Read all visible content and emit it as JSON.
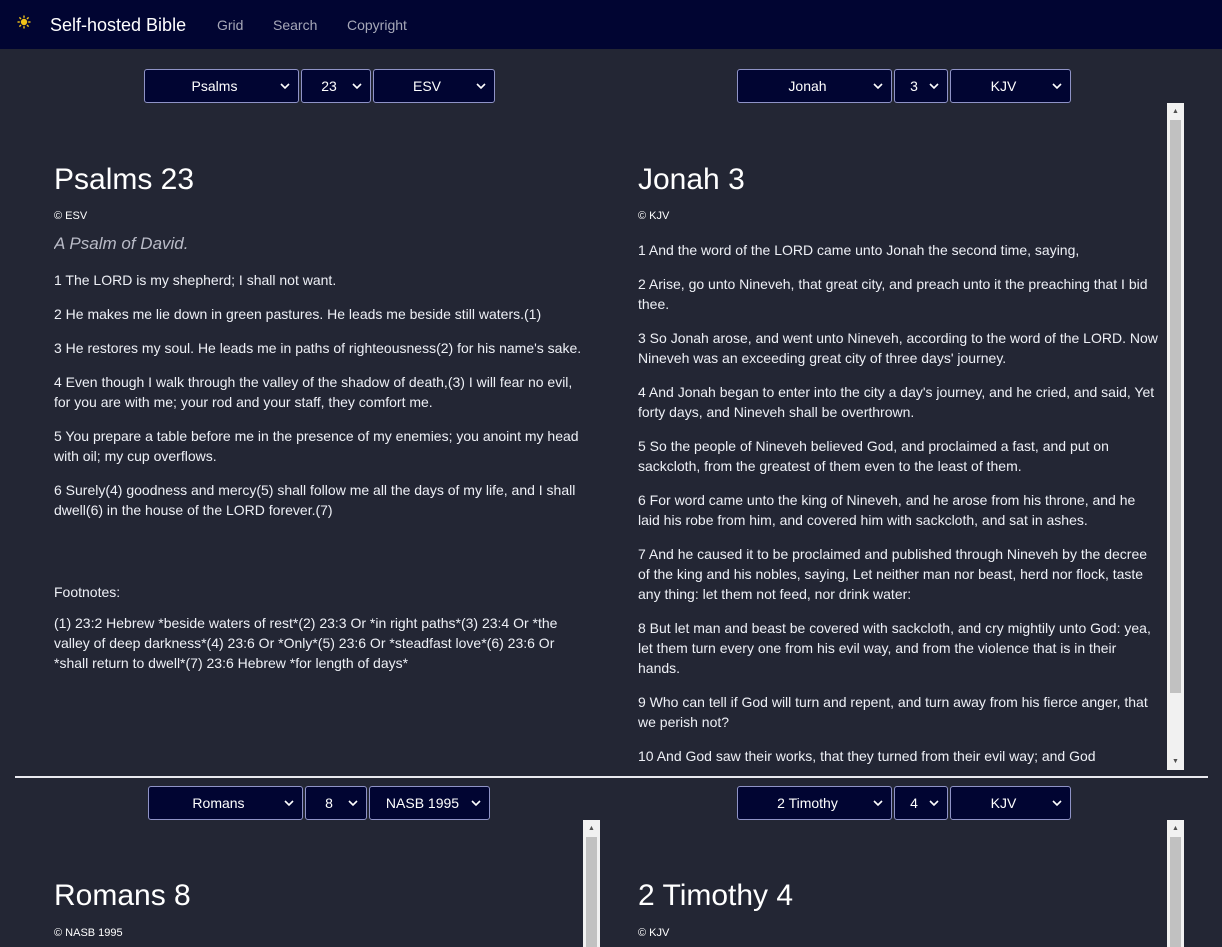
{
  "nav": {
    "brand_icon": "sun-icon",
    "brand": "Self-hosted Bible",
    "links": [
      "Grid",
      "Search",
      "Copyright"
    ]
  },
  "colors": {
    "nav_bg": "#010532",
    "page_bg": "#232634",
    "select_bg": "#010532",
    "select_border": "#8f93c7",
    "brand_icon": "#f2c318"
  },
  "panels": [
    {
      "book": "Psalms",
      "chapter": "23",
      "version": "ESV",
      "title": "Psalms 23",
      "copyright": "© ESV",
      "subtitle": "A Psalm of David.",
      "verses": [
        "1 The LORD is my shepherd; I shall not want.",
        "2 He makes me lie down in green pastures. He leads me beside still waters.(1)",
        "3 He restores my soul. He leads me in paths of righteousness(2) for his name's sake.",
        "4 Even though I walk through the valley of the shadow of death,(3) I will fear no evil, for you are with me; your rod and your staff, they comfort me.",
        "5 You prepare a table before me in the presence of my enemies; you anoint my head with oil; my cup overflows.",
        "6 Surely(4) goodness and mercy(5) shall follow me all the days of my life, and I shall dwell(6) in the house of the LORD forever.(7)"
      ],
      "footnotes_label": "Footnotes:",
      "footnotes": "(1) 23:2 Hebrew *beside waters of rest*(2) 23:3 Or *in right paths*(3) 23:4 Or *the valley of deep darkness*(4) 23:6 Or *Only*(5) 23:6 Or *steadfast love*(6) 23:6 Or *shall return to dwell*(7) 23:6 Hebrew *for length of days*"
    },
    {
      "book": "Jonah",
      "chapter": "3",
      "version": "KJV",
      "title": "Jonah 3",
      "copyright": "© KJV",
      "verses": [
        "1 And the word of the LORD came unto Jonah the second time, saying,",
        "2 Arise, go unto Nineveh, that great city, and preach unto it the preaching that I bid thee.",
        "3 So Jonah arose, and went unto Nineveh, according to the word of the LORD. Now Nineveh was an exceeding great city of three days' journey.",
        "4 And Jonah began to enter into the city a day's journey, and he cried, and said, Yet forty days, and Nineveh shall be overthrown.",
        "5 So the people of Nineveh believed God, and proclaimed a fast, and put on sackcloth, from the greatest of them even to the least of them.",
        "6 For word came unto the king of Nineveh, and he arose from his throne, and he laid his robe from him, and covered him with sackcloth, and sat in ashes.",
        "7 And he caused it to be proclaimed and published through Nineveh by the decree of the king and his nobles, saying, Let neither man nor beast, herd nor flock, taste any thing: let them not feed, nor drink water:",
        "8 But let man and beast be covered with sackcloth, and cry mightily unto God: yea, let them turn every one from his evil way, and from the violence that is in their hands.",
        "9 Who can tell if God will turn and repent, and turn away from his fierce anger, that we perish not?",
        "10 And God saw their works, that they turned from their evil way; and God"
      ]
    },
    {
      "book": "Romans",
      "chapter": "8",
      "version": "NASB 1995",
      "title": "Romans 8",
      "copyright": "© NASB 1995"
    },
    {
      "book": "2 Timothy",
      "chapter": "4",
      "version": "KJV",
      "title": "2 Timothy 4",
      "copyright": "© KJV"
    }
  ]
}
